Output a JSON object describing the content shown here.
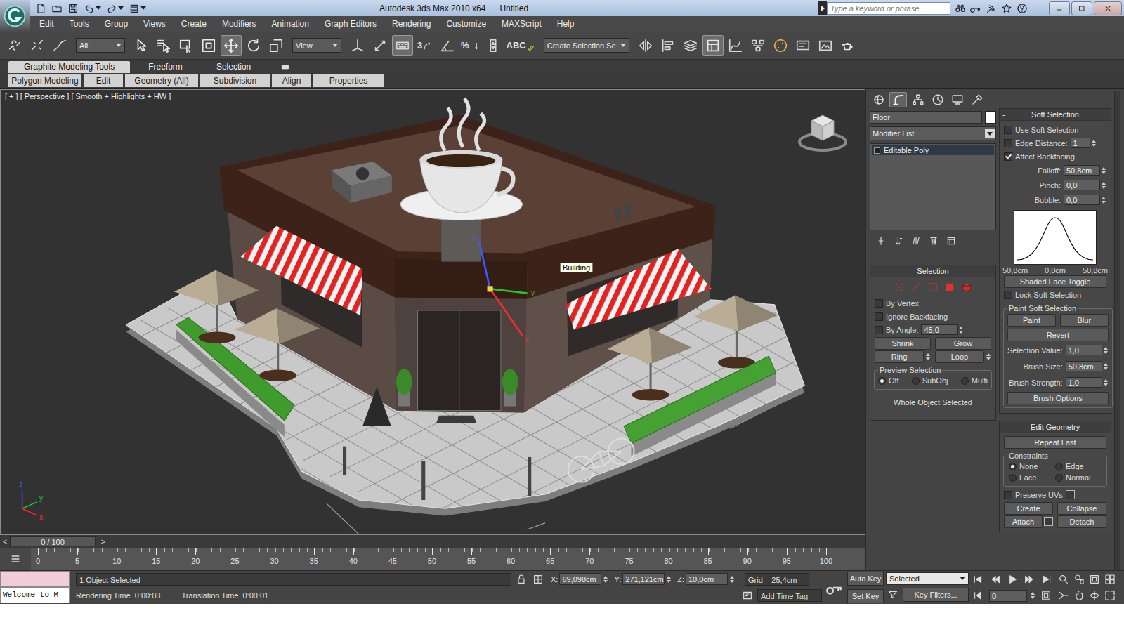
{
  "window": {
    "app": "Autodesk 3ds Max 2010 x64",
    "document": "Untitled",
    "search_placeholder": "Type a keyword or phrase"
  },
  "menu": [
    "Edit",
    "Tools",
    "Group",
    "Views",
    "Create",
    "Modifiers",
    "Animation",
    "Graph Editors",
    "Rendering",
    "Customize",
    "MAXScript",
    "Help"
  ],
  "toolbar": [
    {
      "kind": "tool",
      "selected": false
    },
    {
      "kind": "tool",
      "selected": false
    },
    {
      "kind": "tool",
      "selected": false
    },
    {
      "kind": "dropdown",
      "value": "All"
    },
    {
      "kind": "tool",
      "selected": false
    },
    {
      "kind": "tool",
      "selected": false
    },
    {
      "kind": "tool",
      "selected": false
    },
    {
      "kind": "tool",
      "selected": false
    },
    {
      "kind": "tool",
      "selected": true
    },
    {
      "kind": "tool",
      "selected": false
    },
    {
      "kind": "tool",
      "selected": false
    },
    {
      "kind": "dropdown",
      "value": "View"
    },
    {
      "kind": "tool",
      "selected": false
    },
    {
      "kind": "tool",
      "selected": false
    },
    {
      "kind": "tool",
      "selected": true
    },
    {
      "kind": "tool",
      "selected": false,
      "glyph": "3"
    },
    {
      "kind": "tool",
      "selected": false
    },
    {
      "kind": "tool",
      "selected": false,
      "glyph": "%"
    },
    {
      "kind": "tool",
      "selected": false
    },
    {
      "kind": "tool",
      "selected": false,
      "glyph": "ABC"
    },
    {
      "kind": "dropdown",
      "value": "Create Selection Se"
    },
    {
      "kind": "tool",
      "selected": false
    },
    {
      "kind": "tool",
      "selected": false
    },
    {
      "kind": "tool",
      "selected": false
    },
    {
      "kind": "tool",
      "selected": true
    },
    {
      "kind": "tool",
      "selected": false
    },
    {
      "kind": "tool",
      "selected": false
    },
    {
      "kind": "tool",
      "selected": false
    },
    {
      "kind": "tool",
      "selected": false
    },
    {
      "kind": "tool",
      "selected": false
    },
    {
      "kind": "tool",
      "selected": false
    }
  ],
  "ribbon": {
    "tabs": [
      {
        "label": "Graphite Modeling Tools",
        "selected": true
      },
      {
        "label": "Freeform",
        "selected": false
      },
      {
        "label": "Selection",
        "selected": false
      }
    ],
    "panels": [
      "Polygon Modeling",
      "Edit",
      "Geometry (All)",
      "Subdivision",
      "Align",
      "Properties"
    ]
  },
  "viewport": {
    "label": "[ + ] [ Perspective ] [ Smooth + Highlights + HW ]",
    "tooltip": "Building",
    "gizmo_axes": [
      {
        "label": "z",
        "color": "#3a5cff"
      },
      {
        "label": "y",
        "color": "#2cc22c"
      },
      {
        "label": "x",
        "color": "#ff2a2a"
      }
    ],
    "tripod_axes": [
      {
        "label": "z",
        "color": "#3a5cff"
      },
      {
        "label": "y",
        "color": "#2cc22c"
      },
      {
        "label": "x",
        "color": "#ff2a2a"
      }
    ]
  },
  "time_slider": {
    "prev": "<",
    "reading": "0 / 100",
    "next": ">",
    "level": 0
  },
  "track_bar": {
    "ticks": [
      "0",
      "5",
      "10",
      "15",
      "20",
      "25",
      "30",
      "35",
      "40",
      "45",
      "50",
      "55",
      "60",
      "65",
      "70",
      "75",
      "80",
      "85",
      "90",
      "95",
      "100"
    ]
  },
  "command_panel": {
    "tabs": [
      {
        "selected": false
      },
      {
        "selected": true
      },
      {
        "selected": false
      },
      {
        "selected": false
      },
      {
        "selected": false
      },
      {
        "selected": false
      }
    ],
    "object_name": "Floor",
    "modifier_list": "Modifier List",
    "stack": [
      {
        "label": "Editable Poly",
        "selected": true
      }
    ],
    "selection": {
      "title": "Selection",
      "toggle": "-",
      "levels": [
        {
          "disabled": true
        },
        {
          "disabled": true
        },
        {
          "disabled": true
        },
        {
          "disabled": false
        },
        {
          "disabled": false
        }
      ],
      "checks": [
        {
          "label": "By Vertex",
          "checked": false
        },
        {
          "label": "Ignore Backfacing",
          "checked": false
        }
      ],
      "by_angle": {
        "label": "By Angle:",
        "checked": false,
        "value": "45,0"
      },
      "grow_shrink": [
        "Shrink",
        "Grow"
      ],
      "ring_loop": [
        "Ring",
        "Loop"
      ],
      "preview": {
        "title": "Preview Selection",
        "options": [
          {
            "label": "Off",
            "selected": true
          },
          {
            "label": "SubObj",
            "selected": false
          },
          {
            "label": "Multi",
            "selected": false
          }
        ]
      },
      "status": "Whole Object Selected"
    },
    "soft_selection": {
      "title": "Soft Selection",
      "toggle": "-",
      "use": {
        "label": "Use Soft Selection",
        "checked": false
      },
      "edge_distance": {
        "label": "Edge Distance:",
        "checked": false,
        "value": "1"
      },
      "affect_backfacing": {
        "label": "Affect Backfacing",
        "checked": true
      },
      "params": [
        {
          "label": "Falloff:",
          "value": "50,8cm"
        },
        {
          "label": "Pinch:",
          "value": "0,0"
        },
        {
          "label": "Bubble:",
          "value": "0,0"
        }
      ],
      "curve_labels": [
        "50,8cm",
        "0,0cm",
        "50,8cm"
      ],
      "shaded_face_toggle": "Shaded Face Toggle",
      "lock": {
        "label": "Lock Soft Selection",
        "checked": false
      },
      "paint": {
        "title": "Paint Soft Selection",
        "buttons": [
          "Paint",
          "Blur"
        ],
        "revert": "Revert",
        "params": [
          {
            "label": "Selection Value:",
            "value": "1,0"
          },
          {
            "label": "Brush Size:",
            "value": "50,8cm"
          },
          {
            "label": "Brush Strength:",
            "value": "1,0"
          }
        ],
        "options": "Brush Options"
      }
    },
    "edit_geometry": {
      "title": "Edit Geometry",
      "toggle": "-",
      "repeat_last": "Repeat Last",
      "constraints": {
        "title": "Constraints",
        "options": [
          {
            "label": "None",
            "selected": true
          },
          {
            "label": "Edge",
            "selected": false
          },
          {
            "label": "Face",
            "selected": false
          },
          {
            "label": "Normal",
            "selected": false
          }
        ]
      },
      "preserve_uvs": {
        "label": "Preserve UVs",
        "checked": false
      },
      "rows": [
        [
          {
            "label": "Create",
            "kind": "plain"
          },
          {
            "label": "Collapse",
            "kind": "plain"
          }
        ],
        [
          {
            "label": "Attach",
            "kind": "settings"
          },
          {
            "label": "Detach",
            "kind": "plain"
          }
        ]
      ]
    }
  },
  "status_bar": {
    "listener_output": "Welcome to M",
    "selection": "1 Object Selected",
    "coords": [
      {
        "axis": "X:",
        "value": "69,098cm"
      },
      {
        "axis": "Y:",
        "value": "271,121cm"
      },
      {
        "axis": "Z:",
        "value": "10,0cm"
      }
    ],
    "grid": "Grid = 25,4cm",
    "render_time": {
      "label": "Rendering Time",
      "value": "0:00:03"
    },
    "translation_time": {
      "label": "Translation Time",
      "value": "0:00:01"
    },
    "time_tag": "Add Time Tag",
    "auto_key": "Auto Key",
    "key_mode": "Selected",
    "set_key": "Set Key",
    "key_filters": "Key Filters...",
    "frame": "0"
  }
}
